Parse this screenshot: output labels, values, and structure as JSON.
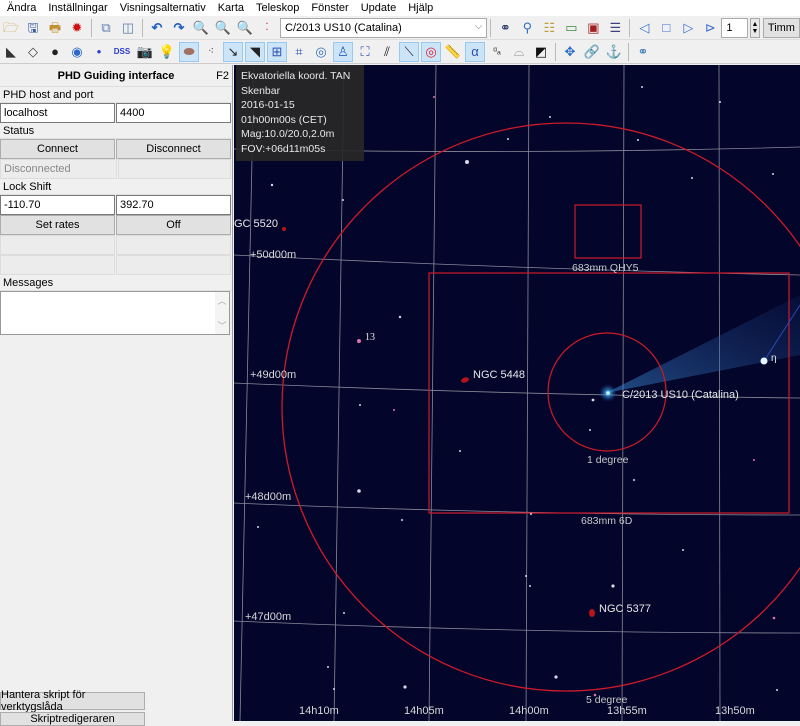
{
  "menubar": {
    "items": [
      "Ändra",
      "Inställningar",
      "Visningsalternativ",
      "Karta",
      "Teleskop",
      "Fönster",
      "Update",
      "Hjälp"
    ]
  },
  "toolbar1": {
    "icons_left": [
      "open-icon",
      "save-icon",
      "print-icon",
      "settings-gear-icon",
      "window-cascade-icon",
      "window-tile-icon",
      "undo-icon",
      "redo-icon",
      "zoom-in-icon",
      "zoom-out-icon",
      "zoom-icon",
      "dots-icon"
    ],
    "object_search": "C/2013 US10 (Catalina)",
    "icons_right": [
      "binoculars-icon",
      "find-user-icon",
      "list-icon",
      "calendar-window-icon",
      "calendar-date-icon",
      "color-bars-icon",
      "step-back-icon",
      "stop-icon",
      "play-icon",
      "step-forward-icon"
    ],
    "step_value": "1",
    "time_unit": "Timm"
  },
  "toolbar2": {
    "icons": [
      "telescope-icon",
      "bell-icon",
      "dark-object-icon",
      "galaxy-icon",
      "star-dot-icon",
      "dss-icon",
      "camera-icon",
      "bulb-icon",
      "nebula-icon",
      "constellation-icon",
      "comet-icon",
      "milky-way-icon",
      "grid-icon",
      "grid-coord-icon",
      "compass-icon",
      "constellation-figure-icon",
      "constellation-boundary-icon",
      "milky-way-band-icon",
      "line-icon",
      "target-icon",
      "ruler-icon",
      "alpha-icon",
      "label-icon",
      "horizon-icon",
      "contrast-icon",
      "move-icon",
      "link-icon",
      "anchor-icon",
      "planets-icon"
    ],
    "dss_label": "DSS"
  },
  "panel": {
    "title": "PHD Guiding interface",
    "shortcut": "F2",
    "host_label": "PHD host and port",
    "host_value": "localhost",
    "port_value": "4400",
    "status_label": "Status",
    "connect_label": "Connect",
    "disconnect_label": "Disconnect",
    "status_value": "Disconnected",
    "lockshift_label": "Lock Shift",
    "lockshift_x": "-110.70",
    "lockshift_y": "392.70",
    "setrates_label": "Set rates",
    "off_label": "Off",
    "messages_label": "Messages",
    "messages_value": "",
    "manage_scripts_label": "Hantera skript för verktygslåda",
    "script_editor_label": "Skriptredigeraren"
  },
  "map": {
    "info": {
      "projection": "Ekvatoriella koord. TAN",
      "mode": "Skenbar",
      "date": "2016-01-15",
      "time": "01h00m00s (CET)",
      "mag": "Mag:10.0/20.0,2.0m",
      "fov": "FOV:+06d11m05s"
    },
    "dec_labels": [
      "+50d00m",
      "+49d00m",
      "+48d00m",
      "+47d00m"
    ],
    "ra_labels": [
      "14h10m",
      "14h05m",
      "14h00m",
      "13h55m",
      "13h50m"
    ],
    "objects": {
      "comet": "C/2013 US10 (Catalina)",
      "ngc5448": "NGC 5448",
      "ngc5377": "NGC 5377",
      "ngc5520": "GC 5520",
      "star13": "13",
      "eta": "η"
    },
    "fov_labels": {
      "qhy5": "683mm QHY5",
      "sixd": "683mm 6D",
      "one_degree": "1 degree",
      "five_degree": "5 degree"
    },
    "colors": {
      "background": "#03052a",
      "fov_outline": "#d01a2a",
      "grid": "#8a8a9a",
      "comet": "#3aa6e8"
    }
  }
}
